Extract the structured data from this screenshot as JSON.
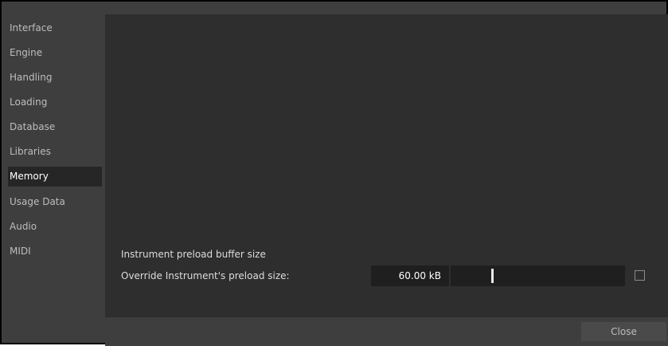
{
  "sidebar": {
    "items": [
      {
        "label": "Interface",
        "selected": false
      },
      {
        "label": "Engine",
        "selected": false
      },
      {
        "label": "Handling",
        "selected": false
      },
      {
        "label": "Loading",
        "selected": false
      },
      {
        "label": "Database",
        "selected": false
      },
      {
        "label": "Libraries",
        "selected": false
      },
      {
        "label": "Memory",
        "selected": true
      },
      {
        "label": "Usage Data",
        "selected": false
      },
      {
        "label": "Audio",
        "selected": false
      },
      {
        "label": "MIDI",
        "selected": false
      }
    ]
  },
  "memory": {
    "heading": "Instrument preload buffer size",
    "override_label": "Override Instrument's preload size:",
    "preload_value": "60.00 kB",
    "slider_level": 0.25,
    "override_checked": false
  },
  "footer": {
    "close_label": "Close"
  },
  "colors": {
    "panel_bg": "#2e2e2e",
    "window_bg": "#3e3e3e",
    "field_bg": "#1f1f1f",
    "selected_item_bg": "#262626"
  }
}
